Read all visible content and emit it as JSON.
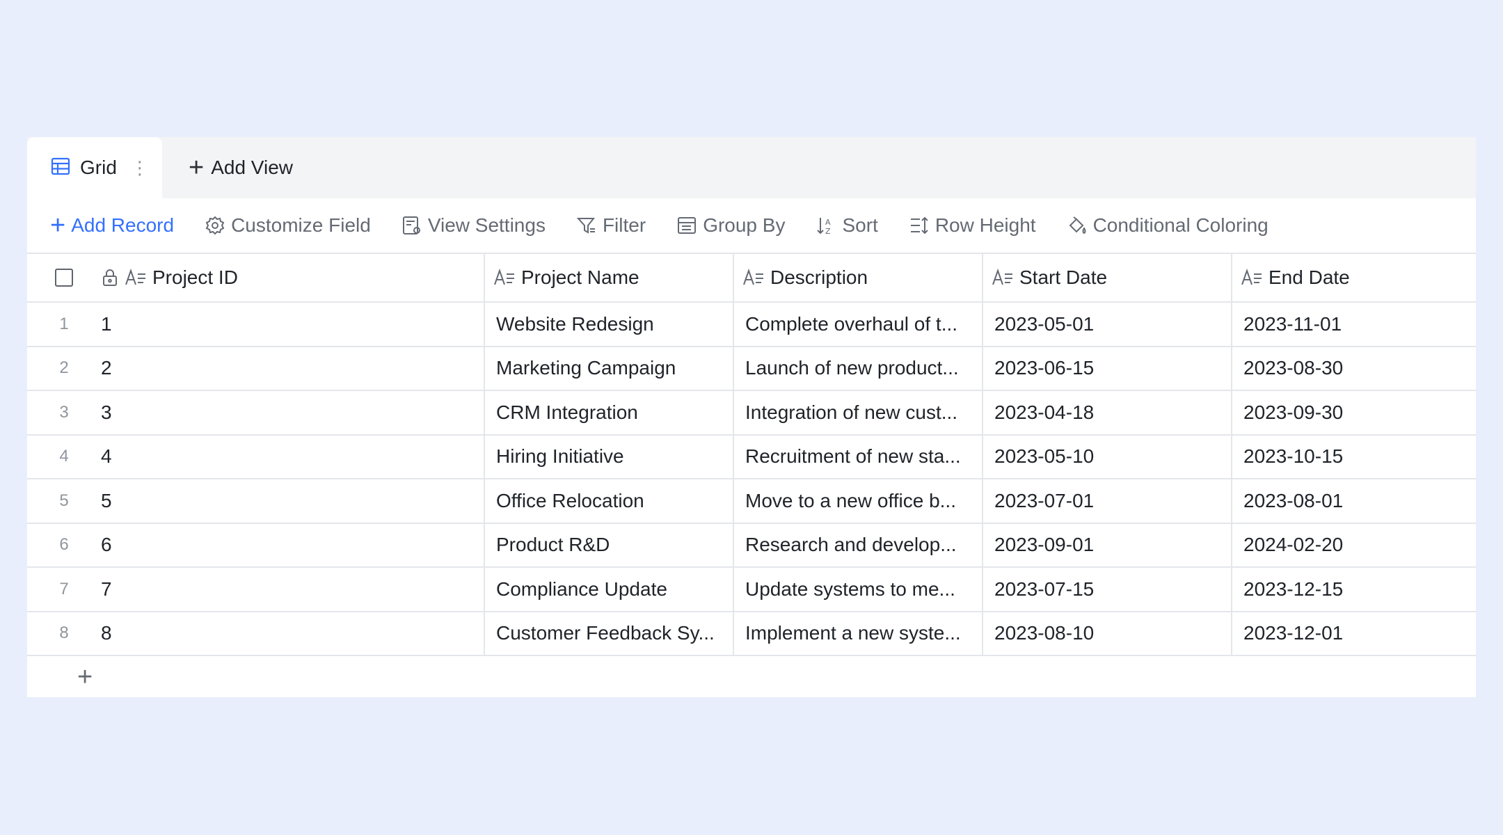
{
  "tabs": {
    "grid_label": "Grid",
    "add_view_label": "Add View"
  },
  "toolbar": {
    "add_record": "Add Record",
    "customize_field": "Customize Field",
    "view_settings": "View Settings",
    "filter": "Filter",
    "group_by": "Group By",
    "sort": "Sort",
    "row_height": "Row Height",
    "conditional_coloring": "Conditional Coloring"
  },
  "columns": [
    "Project ID",
    "Project Name",
    "Description",
    "Start Date",
    "End Date"
  ],
  "rows": [
    {
      "num": "1",
      "id": "1",
      "name": "Website Redesign",
      "desc": "Complete overhaul of t...",
      "start": "2023-05-01",
      "end": "2023-11-01"
    },
    {
      "num": "2",
      "id": "2",
      "name": "Marketing Campaign",
      "desc": "Launch of new product...",
      "start": "2023-06-15",
      "end": "2023-08-30"
    },
    {
      "num": "3",
      "id": "3",
      "name": "CRM Integration",
      "desc": "Integration of new cust...",
      "start": "2023-04-18",
      "end": "2023-09-30"
    },
    {
      "num": "4",
      "id": "4",
      "name": "Hiring Initiative",
      "desc": "Recruitment of new sta...",
      "start": "2023-05-10",
      "end": "2023-10-15"
    },
    {
      "num": "5",
      "id": "5",
      "name": "Office Relocation",
      "desc": "Move to a new office b...",
      "start": "2023-07-01",
      "end": "2023-08-01"
    },
    {
      "num": "6",
      "id": "6",
      "name": "Product R&D",
      "desc": "Research and develop...",
      "start": "2023-09-01",
      "end": "2024-02-20"
    },
    {
      "num": "7",
      "id": "7",
      "name": "Compliance Update",
      "desc": "Update systems to me...",
      "start": "2023-07-15",
      "end": "2023-12-15"
    },
    {
      "num": "8",
      "id": "8",
      "name": "Customer Feedback Sy...",
      "desc": "Implement a new syste...",
      "start": "2023-08-10",
      "end": "2023-12-01"
    }
  ],
  "colors": {
    "accent": "#3370ff",
    "background": "#e8eefc"
  }
}
